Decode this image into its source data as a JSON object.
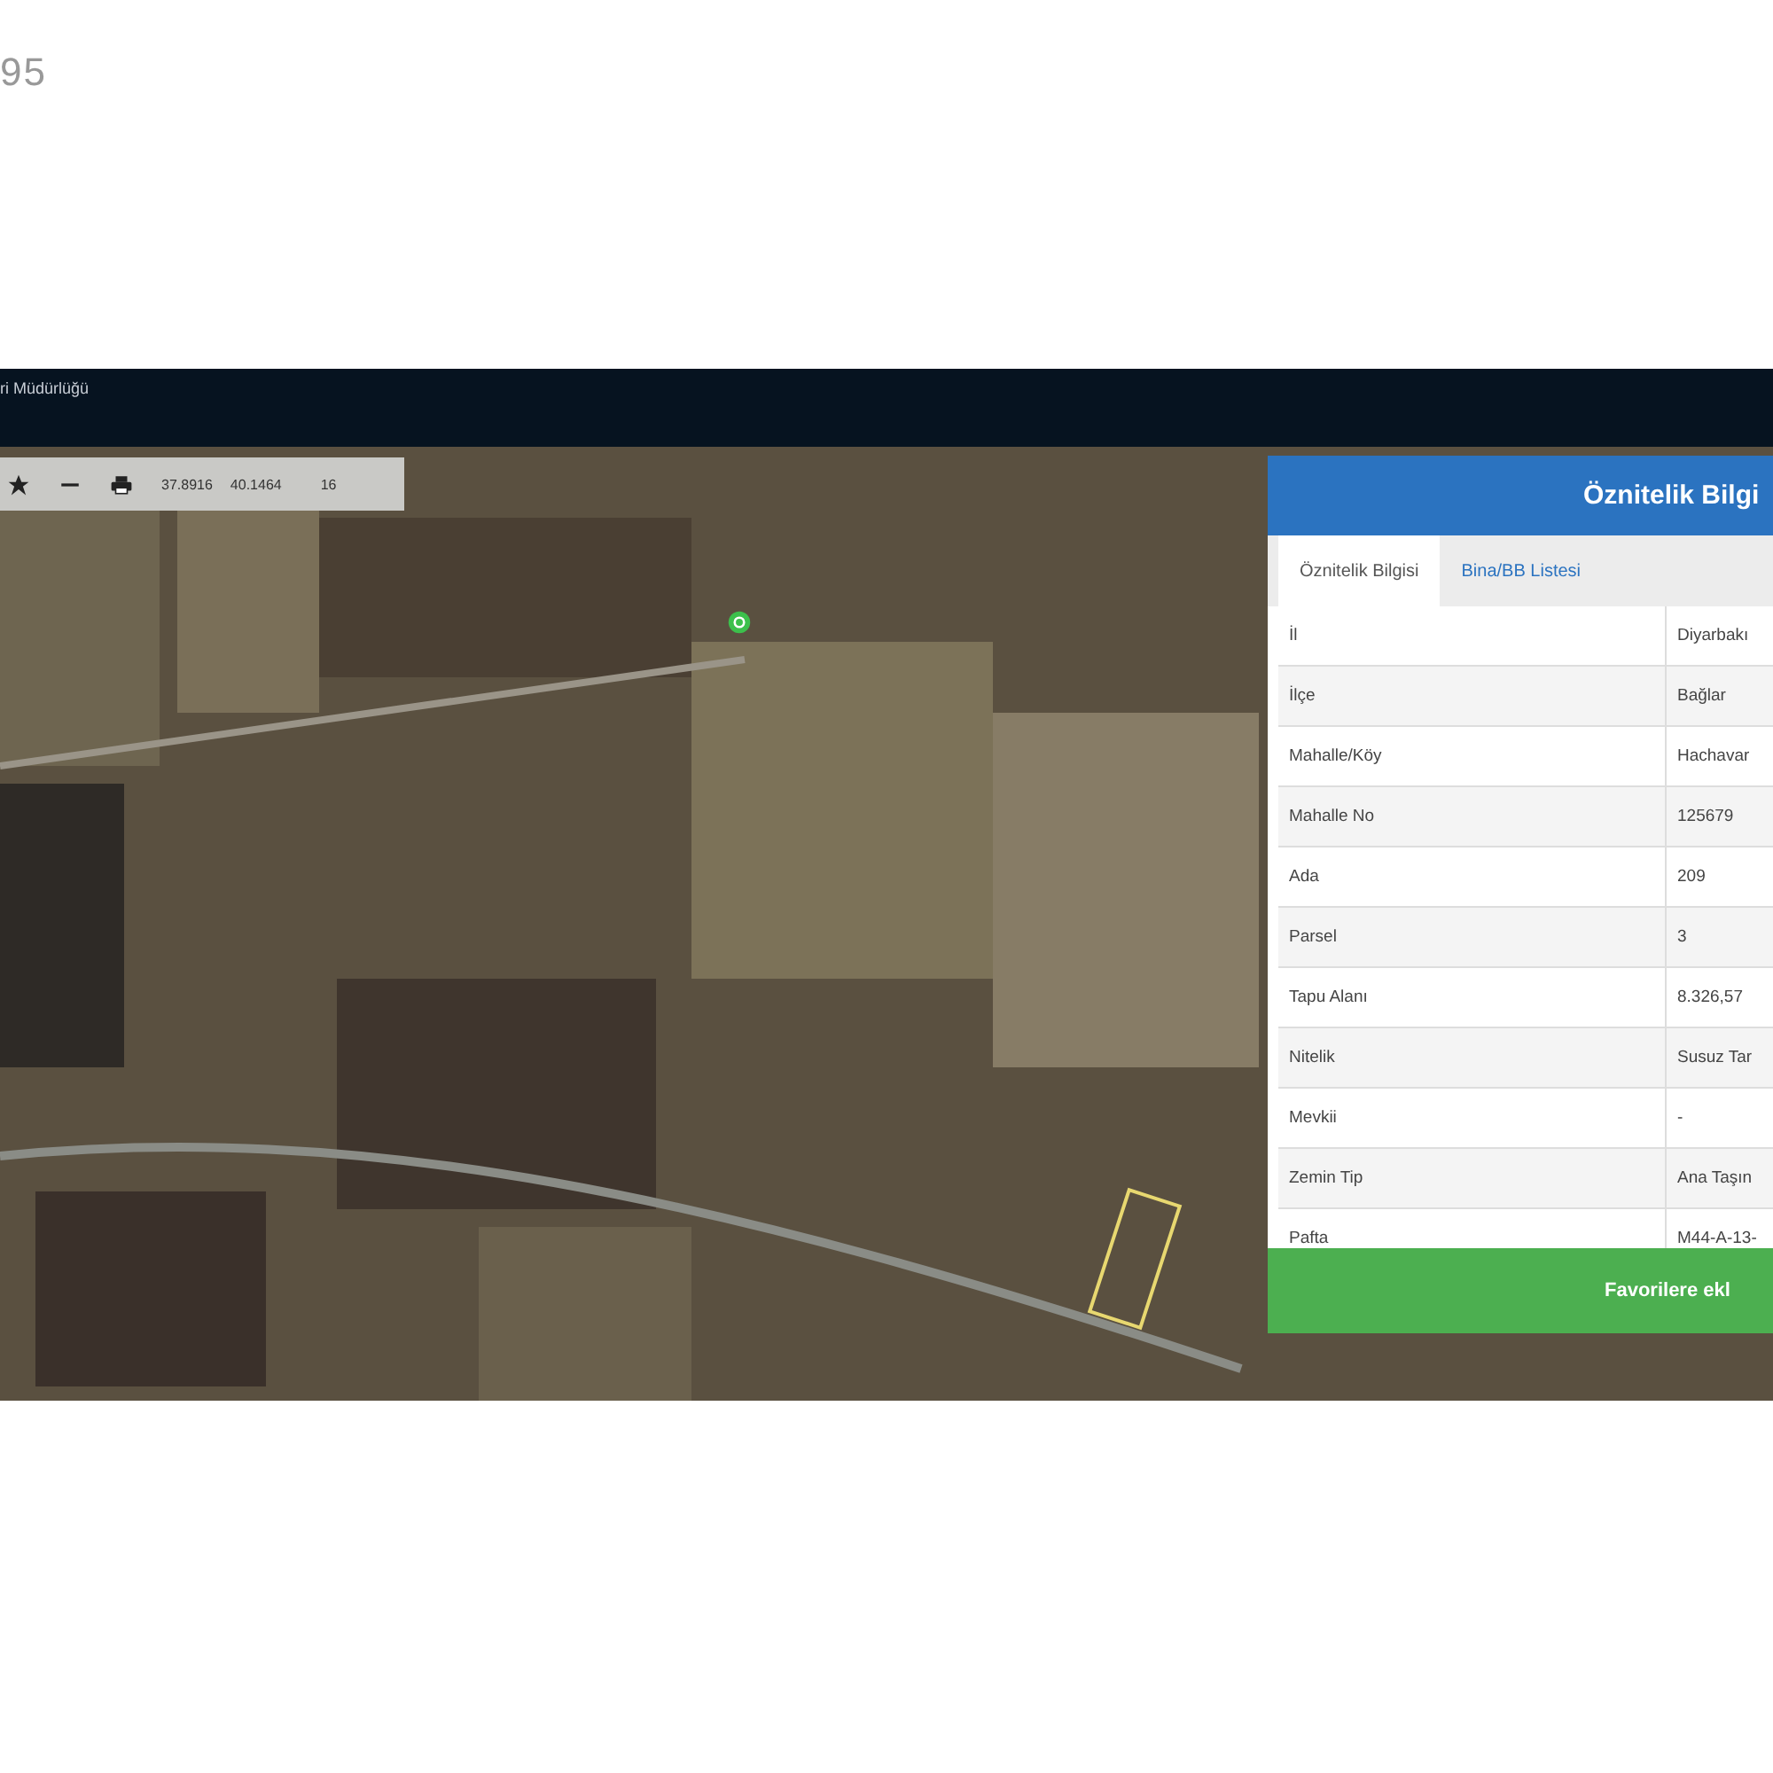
{
  "page_number": "95",
  "header": {
    "title": "ri Müdürlüğü"
  },
  "toolbar": {
    "latitude": "37.8916",
    "longitude": "40.1464",
    "zoom": "16"
  },
  "panel": {
    "title": "Öznitelik Bilgi",
    "tabs": [
      {
        "label": "Öznitelik Bilgisi",
        "selected": true
      },
      {
        "label": "Bina/BB Listesi",
        "selected": false
      }
    ],
    "rows": [
      {
        "label": "İl",
        "value": "Diyarbakı"
      },
      {
        "label": "İlçe",
        "value": "Bağlar"
      },
      {
        "label": "Mahalle/Köy",
        "value": "Hachavar"
      },
      {
        "label": "Mahalle No",
        "value": "125679"
      },
      {
        "label": "Ada",
        "value": "209"
      },
      {
        "label": "Parsel",
        "value": "3"
      },
      {
        "label": "Tapu Alanı",
        "value": "8.326,57"
      },
      {
        "label": "Nitelik",
        "value": "Susuz Tar"
      },
      {
        "label": "Mevkii",
        "value": "-"
      },
      {
        "label": "Zemin Tip",
        "value": "Ana Taşın"
      },
      {
        "label": "Pafta",
        "value": "M44-A-13-"
      }
    ],
    "button": "Favorilere ekl"
  }
}
